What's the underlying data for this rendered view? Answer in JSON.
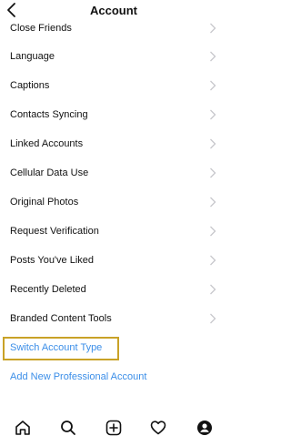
{
  "header": {
    "title": "Account",
    "back_icon": "chevron-left-icon"
  },
  "menu": {
    "items": [
      {
        "label": "Close Friends",
        "icon": "chevron-right-icon"
      },
      {
        "label": "Language",
        "icon": "chevron-right-icon"
      },
      {
        "label": "Captions",
        "icon": "chevron-right-icon"
      },
      {
        "label": "Contacts Syncing",
        "icon": "chevron-right-icon"
      },
      {
        "label": "Linked Accounts",
        "icon": "chevron-right-icon"
      },
      {
        "label": "Cellular Data Use",
        "icon": "chevron-right-icon"
      },
      {
        "label": "Original Photos",
        "icon": "chevron-right-icon"
      },
      {
        "label": "Request Verification",
        "icon": "chevron-right-icon"
      },
      {
        "label": "Posts You've Liked",
        "icon": "chevron-right-icon"
      },
      {
        "label": "Recently Deleted",
        "icon": "chevron-right-icon"
      },
      {
        "label": "Branded Content Tools",
        "icon": "chevron-right-icon"
      }
    ],
    "switch_account_type": "Switch Account Type",
    "add_professional_account": "Add New Professional Account"
  },
  "tabbar": {
    "items": [
      "home-icon",
      "search-icon",
      "add-post-icon",
      "heart-icon",
      "profile-icon"
    ]
  },
  "colors": {
    "link_blue": "#3b8ee8",
    "highlight_border": "#c9a227",
    "text": "#111111",
    "chevron": "#c7c7cc"
  }
}
